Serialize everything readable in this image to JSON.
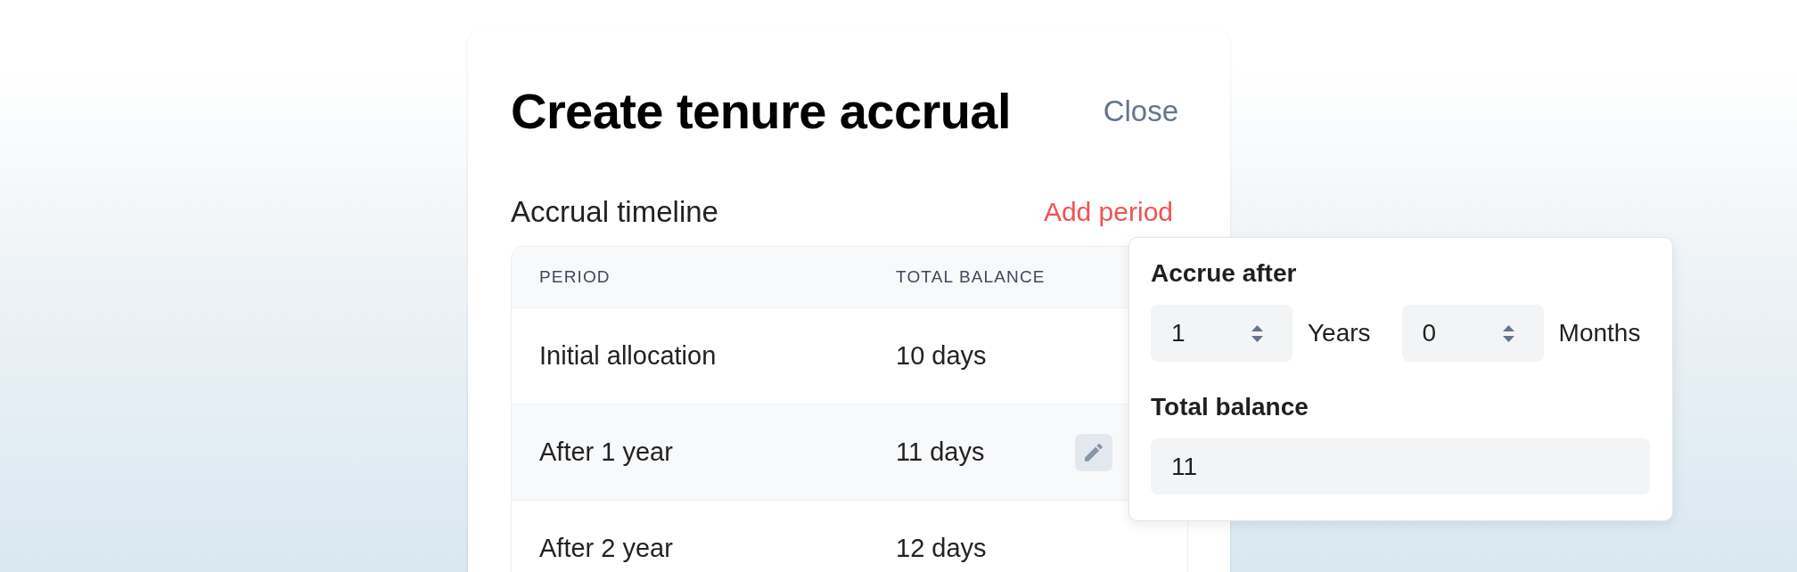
{
  "dialog": {
    "title": "Create tenure accrual",
    "close_label": "Close"
  },
  "timeline": {
    "heading": "Accrual timeline",
    "add_label": "Add period"
  },
  "table": {
    "columns": [
      "PERIOD",
      "TOTAL BALANCE"
    ],
    "rows": [
      {
        "period": "Initial allocation",
        "total_balance": "10 days",
        "selected": false
      },
      {
        "period": "After 1 year",
        "total_balance": "11 days",
        "selected": true
      },
      {
        "period": "After 2 year",
        "total_balance": "12 days",
        "selected": false
      }
    ]
  },
  "popover": {
    "accrue_label": "Accrue after",
    "fields": [
      {
        "value": "1",
        "unit": "Years"
      },
      {
        "value": "0",
        "unit": "Months"
      }
    ],
    "balance_label": "Total balance",
    "balance_value": "11"
  }
}
